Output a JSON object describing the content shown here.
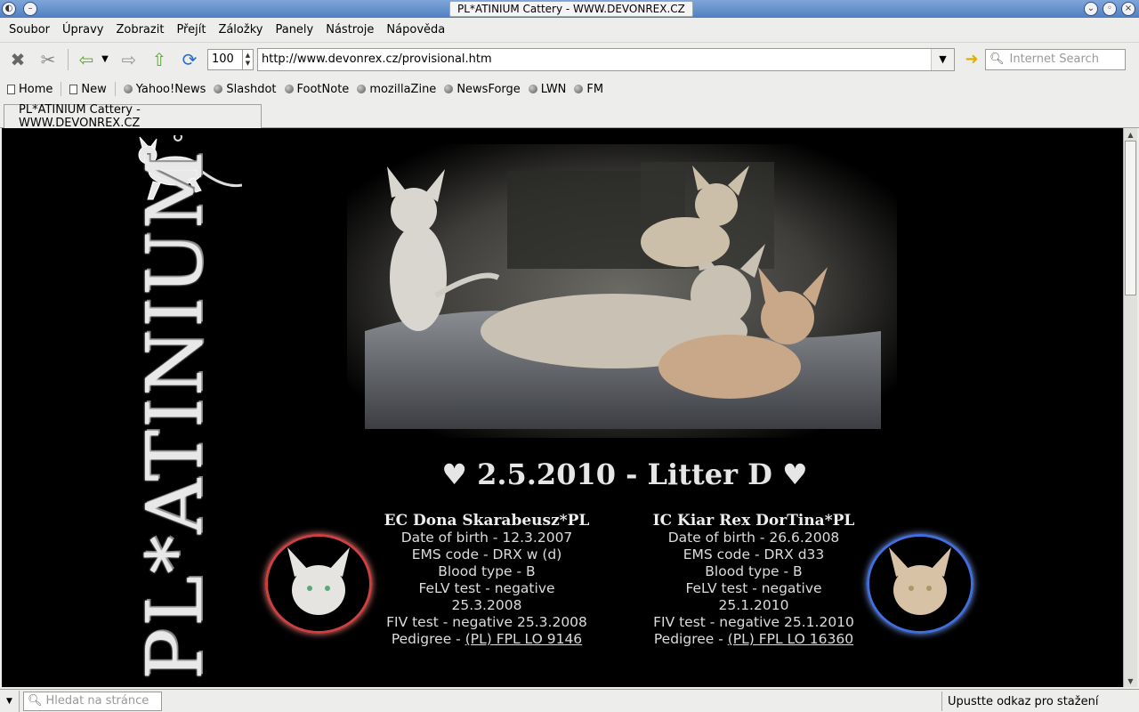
{
  "window": {
    "title": "PL*ATINIUM Cattery - WWW.DEVONREX.CZ"
  },
  "menu": [
    "Soubor",
    "Úpravy",
    "Zobrazit",
    "Přejít",
    "Záložky",
    "Panely",
    "Nástroje",
    "Nápověda"
  ],
  "toolbar": {
    "zoom": "100",
    "url": "http://www.devonrex.cz/provisional.htm",
    "search_placeholder": "Internet Search"
  },
  "bookmarks": [
    "Home",
    "New",
    "Yahoo!News",
    "Slashdot",
    "FootNote",
    "mozillaZine",
    "NewsForge",
    "LWN",
    "FM"
  ],
  "tab": {
    "label": "PL*ATINIUM Cattery - WWW.DEVONREX.CZ"
  },
  "page": {
    "logo_text": "PL*ATINIUM",
    "litter_title": "♥ 2.5.2010 - Litter D ♥",
    "mother": {
      "name": "EC Dona Skarabeusz*PL",
      "dob": "Date of birth - 12.3.2007",
      "ems": "EMS code - DRX w (d)",
      "blood": "Blood type - B",
      "felv": "FeLV test - negative",
      "felv_date": "25.3.2008",
      "fiv": "FIV test - negative 25.3.2008",
      "pedigree_label": "Pedigree - ",
      "pedigree_link": "(PL) FPL LO 9146"
    },
    "father": {
      "name": "IC Kiar Rex DorTina*PL",
      "dob": "Date of birth - 26.6.2008",
      "ems": "EMS code - DRX d33",
      "blood": "Blood type - B",
      "felv": "FeLV test - negative",
      "felv_date": "25.1.2010",
      "fiv": "FIV test - negative 25.1.2010",
      "pedigree_label": "Pedigree - ",
      "pedigree_link": "(PL) FPL LO 16360"
    }
  },
  "statusbar": {
    "find_placeholder": "Hledat na stránce",
    "status": "Upustte odkaz pro stažení"
  },
  "colors": {
    "titlebar": "#5b8ac8",
    "content_bg": "#000000",
    "mother_ring": "#d04040",
    "father_ring": "#4070e0"
  }
}
